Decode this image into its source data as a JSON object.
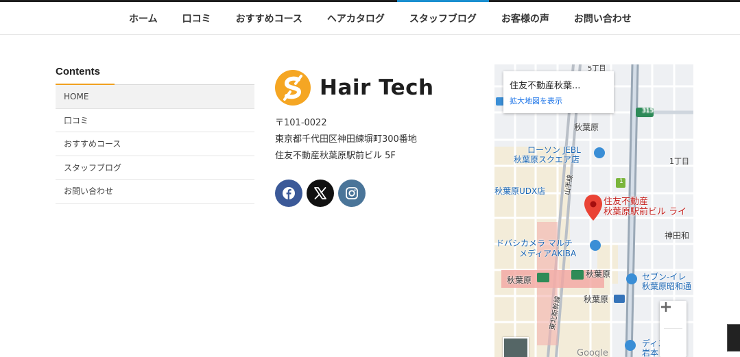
{
  "nav": {
    "items": [
      {
        "label": "ホーム"
      },
      {
        "label": "口コミ"
      },
      {
        "label": "おすすめコース"
      },
      {
        "label": "ヘアカタログ"
      },
      {
        "label": "スタッフブログ"
      },
      {
        "label": "お客様の声"
      },
      {
        "label": "お問い合わせ"
      }
    ],
    "active_index": 4,
    "accent_color": "#1a8fd0"
  },
  "contents": {
    "title": "Contents",
    "accent_color": "#f0a020",
    "items": [
      {
        "label": "HOME"
      },
      {
        "label": "口コミ"
      },
      {
        "label": "おすすめコース"
      },
      {
        "label": "スタッフブログ"
      },
      {
        "label": "お問い合わせ"
      }
    ]
  },
  "company": {
    "logo_text": "Hair Tech",
    "logo_mark_color": "#f5a623",
    "postal": "〒101-0022",
    "address_line1": "東京都千代田区神田練塀町300番地",
    "address_line2": "住友不動産秋葉原駅前ビル 5F",
    "social": [
      {
        "name": "facebook",
        "icon": "facebook-icon"
      },
      {
        "name": "x",
        "icon": "x-icon"
      },
      {
        "name": "instagram",
        "icon": "instagram-icon"
      }
    ]
  },
  "map": {
    "card_title": "住友不動産秋葉...",
    "card_link": "拡大地図を表示",
    "pin_label_line1": "住友不動産",
    "pin_label_line2": "秋葉原駅前ビル ライ",
    "labels": {
      "l01": "315",
      "l02": "秋葉原",
      "l03": "ローソン JEBL",
      "l04": "秋葉原スクエア店",
      "l05": "1丁目",
      "l06": "秋葉原UDX店",
      "l07": "神田和",
      "l08": "ドバシカメラ マルチ",
      "l09": "メディアAKIBA",
      "l10": "秋葉原",
      "l11": "秋葉原",
      "l12": "セブン-イレ",
      "l13": "秋葉原昭和通",
      "l14": "秋葉原",
      "l15": "ディス",
      "l16": "岩本",
      "l17": "1",
      "l18": "山手線",
      "l19": "東北新幹線",
      "l20": "5丁目"
    },
    "google_label": "Google"
  }
}
